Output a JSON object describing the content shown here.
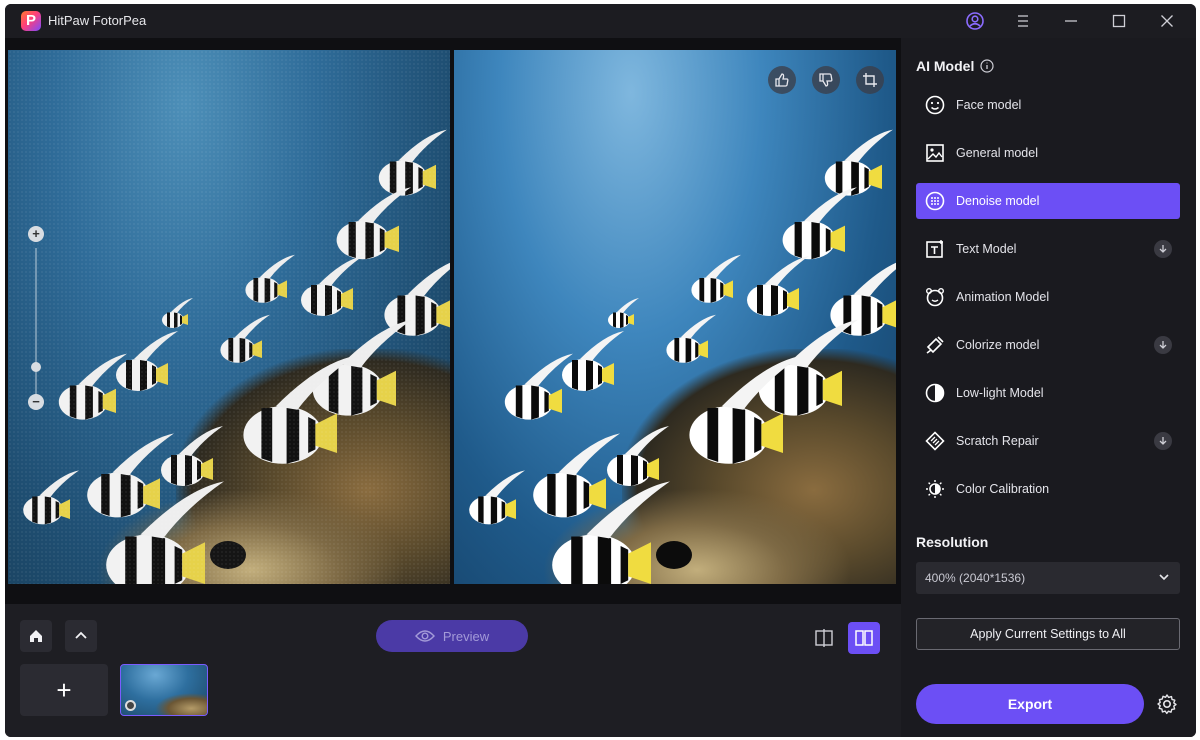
{
  "app": {
    "title": "HitPaw FotorPea",
    "logo_letter": "P"
  },
  "canvas": {
    "zoom_in_label": "+",
    "zoom_out_label": "−"
  },
  "bottom_bar": {
    "preview_label": "Preview",
    "add_label": "+"
  },
  "panel": {
    "ai_model_title": "AI Model",
    "models": [
      {
        "label": "Face model",
        "icon": "face-icon",
        "active": false,
        "download": false
      },
      {
        "label": "General model",
        "icon": "image-icon",
        "active": false,
        "download": false
      },
      {
        "label": "Denoise model",
        "icon": "denoise-icon",
        "active": true,
        "download": false
      },
      {
        "label": "Text Model",
        "icon": "text-icon",
        "active": false,
        "download": true
      },
      {
        "label": "Animation Model",
        "icon": "animation-icon",
        "active": false,
        "download": false
      },
      {
        "label": "Colorize model",
        "icon": "colorize-icon",
        "active": false,
        "download": true
      },
      {
        "label": "Low-light Model",
        "icon": "lowlight-icon",
        "active": false,
        "download": false
      },
      {
        "label": "Scratch Repair",
        "icon": "scratch-icon",
        "active": false,
        "download": true
      },
      {
        "label": "Color Calibration",
        "icon": "color-calibration-icon",
        "active": false,
        "download": false
      }
    ],
    "resolution_title": "Resolution",
    "resolution_value": "400% (2040*1536)",
    "apply_label": "Apply Current Settings to All",
    "export_label": "Export"
  },
  "colors": {
    "accent": "#6c4ff5",
    "background": "#161619",
    "panel": "#1a1a1f"
  }
}
